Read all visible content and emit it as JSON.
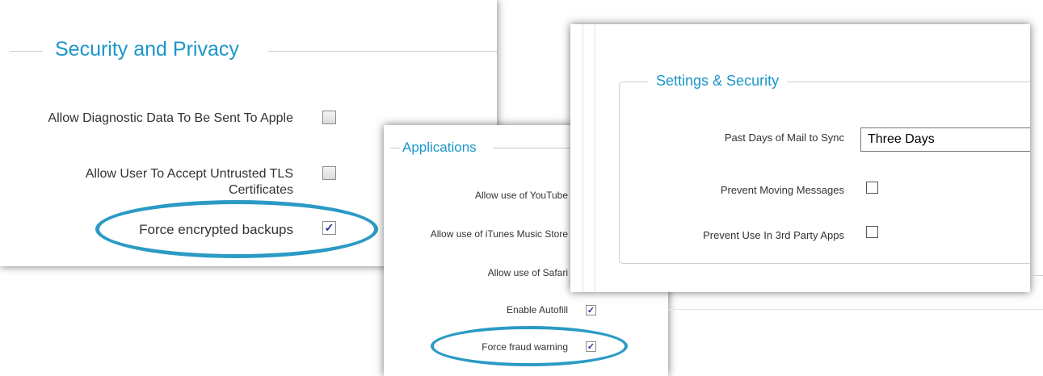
{
  "security_privacy": {
    "title": "Security and Privacy",
    "rows": [
      {
        "label": "Allow Diagnostic Data To Be Sent To Apple",
        "checked": false
      },
      {
        "label": "Allow User To Accept Untrusted TLS Certificates",
        "checked": false
      },
      {
        "label": "Force encrypted backups",
        "checked": true
      }
    ]
  },
  "applications": {
    "title": "Applications",
    "rows": [
      {
        "label": "Allow use of YouTube",
        "checked": true
      },
      {
        "label": "Allow use of iTunes Music Store",
        "checked": true
      },
      {
        "label": "Allow use of Safari",
        "checked": true
      },
      {
        "label": "Enable Autofill",
        "checked": true
      },
      {
        "label": "Force fraud warning",
        "checked": true
      }
    ]
  },
  "settings_security": {
    "title": "Settings & Security",
    "mail_sync_label": "Past Days of Mail to Sync",
    "mail_sync_value": "Three Days",
    "prevent_moving_label": "Prevent Moving Messages",
    "prevent_moving_checked": false,
    "prevent_3rd_party_label": "Prevent Use In 3rd Party Apps",
    "prevent_3rd_party_checked": false
  },
  "colors": {
    "accent": "#1b96c9",
    "highlight_oval": "#2b9ac5",
    "check_mark": "#2a2f9a"
  },
  "icons": {
    "check": "check-icon"
  }
}
